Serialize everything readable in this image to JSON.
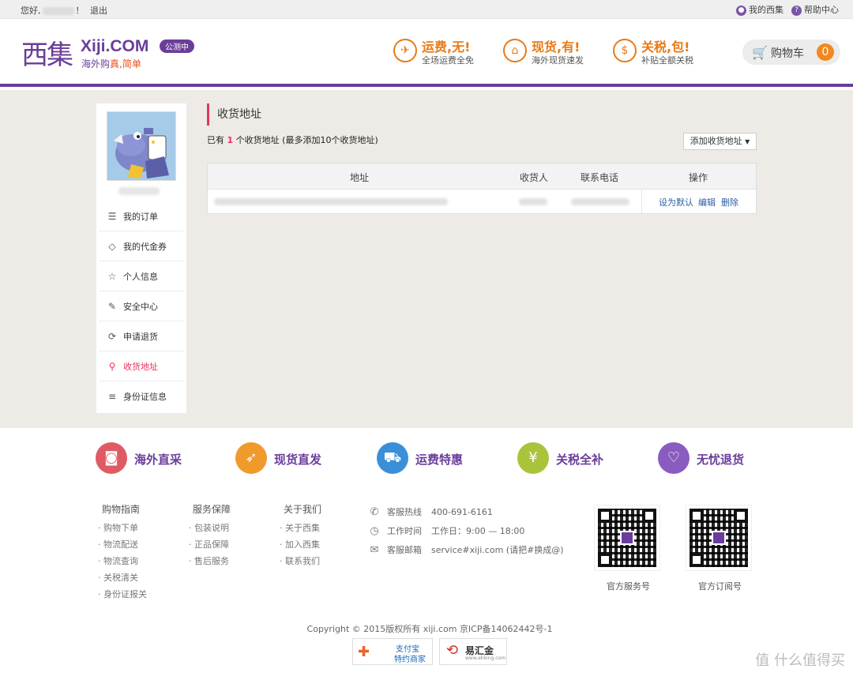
{
  "topbar": {
    "greeting": "您好,",
    "greeting_end": "！",
    "logout": "退出",
    "my_xiji": "我的西集",
    "help": "帮助中心"
  },
  "header": {
    "logo_cn": "西集",
    "logo_en": "Xiji.COM",
    "slogan_prefix": "海外购",
    "slogan_highlight": "真,简单",
    "beta_badge": "公测中",
    "promos": [
      {
        "title": "运费,无!",
        "sub": "全场运费全免",
        "icon": "plane-icon"
      },
      {
        "title": "现货,有!",
        "sub": "海外现货速发",
        "icon": "gift-icon"
      },
      {
        "title": "关税,包!",
        "sub": "补贴全额关税",
        "icon": "money-icon"
      }
    ],
    "cart_label": "购物车",
    "cart_count": "0"
  },
  "sidebar": {
    "items": [
      {
        "label": "我的订单",
        "icon": "order-icon",
        "active": false
      },
      {
        "label": "我的代金券",
        "icon": "coupon-icon",
        "active": false
      },
      {
        "label": "个人信息",
        "icon": "star-icon",
        "active": false
      },
      {
        "label": "安全中心",
        "icon": "edit-icon",
        "active": false
      },
      {
        "label": "申请退货",
        "icon": "refresh-icon",
        "active": false
      },
      {
        "label": "收货地址",
        "icon": "location-icon",
        "active": true
      },
      {
        "label": "身份证信息",
        "icon": "id-card-icon",
        "active": false
      }
    ]
  },
  "content": {
    "title": "收货地址",
    "count_prefix": "已有",
    "count": "1",
    "count_suffix": "个收货地址 (最多添加10个收货地址)",
    "add_button": "添加收货地址",
    "table": {
      "headers": [
        "地址",
        "收货人",
        "联系电话",
        "操作"
      ],
      "ops": [
        "设为默认",
        "编辑",
        "删除"
      ]
    }
  },
  "footer": {
    "features": [
      {
        "label": "海外直采",
        "color": "#e05a66"
      },
      {
        "label": "现货直发",
        "color": "#f09a2c"
      },
      {
        "label": "运费特惠",
        "color": "#3a8fd9"
      },
      {
        "label": "关税全补",
        "color": "#a9c43a"
      },
      {
        "label": "无忧退货",
        "color": "#8a5cbf"
      }
    ],
    "columns": [
      {
        "title": "购物指南",
        "items": [
          "购物下单",
          "物流配送",
          "物流查询",
          "关税清关",
          "身份证报关"
        ]
      },
      {
        "title": "服务保障",
        "items": [
          "包装说明",
          "正品保障",
          "售后服务"
        ]
      },
      {
        "title": "关于我们",
        "items": [
          "关于西集",
          "加入西集",
          "联系我们"
        ]
      }
    ],
    "contact": [
      {
        "label": "客服热线",
        "value": "400-691-6161",
        "icon": "phone-icon"
      },
      {
        "label": "工作时间",
        "value": "工作日：9:00 — 18:00",
        "icon": "clock-icon"
      },
      {
        "label": "客服邮箱",
        "value": "service#xiji.com (请把#换成@)",
        "icon": "mail-icon"
      }
    ],
    "qr": [
      "官方服务号",
      "官方订阅号"
    ],
    "copyright": "Copyright © 2015版权所有 xiji.com 京ICP备14062442号-1",
    "badge_alipay_1": "支付宝",
    "badge_alipay_2": "特约商家",
    "badge_ehking": "易汇金",
    "badge_ehking_url": "www.ehking.com",
    "watermark": "值 什么值得买"
  }
}
